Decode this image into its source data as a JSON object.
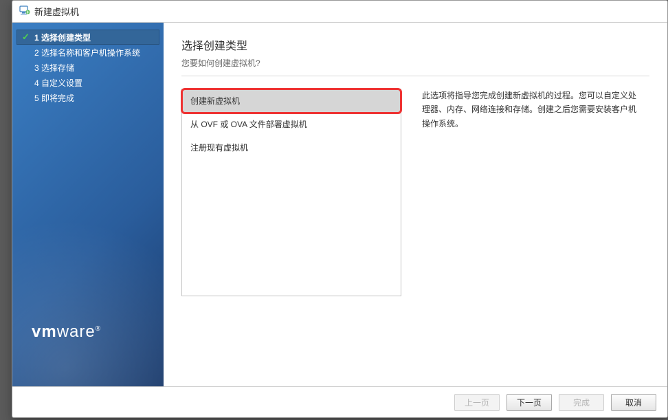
{
  "window": {
    "title": "新建虚拟机"
  },
  "sidebar": {
    "steps": [
      {
        "label": "1 选择创建类型",
        "active": true
      },
      {
        "label": "2 选择名称和客户机操作系统",
        "active": false
      },
      {
        "label": "3 选择存储",
        "active": false
      },
      {
        "label": "4 自定义设置",
        "active": false
      },
      {
        "label": "5 即将完成",
        "active": false
      }
    ]
  },
  "main": {
    "title": "选择创建类型",
    "subtitle": "您要如何创建虚拟机?",
    "options": [
      {
        "label": "创建新虚拟机",
        "selected": true,
        "highlight": true
      },
      {
        "label": "从 OVF 或 OVA 文件部署虚拟机",
        "selected": false
      },
      {
        "label": "注册现有虚拟机",
        "selected": false
      }
    ],
    "description": "此选项将指导您完成创建新虚拟机的过程。您可以自定义处理器、内存、网络连接和存储。创建之后您需要安装客户机操作系统。"
  },
  "footer": {
    "back": "上一页",
    "next": "下一页",
    "finish": "完成",
    "cancel": "取消"
  }
}
